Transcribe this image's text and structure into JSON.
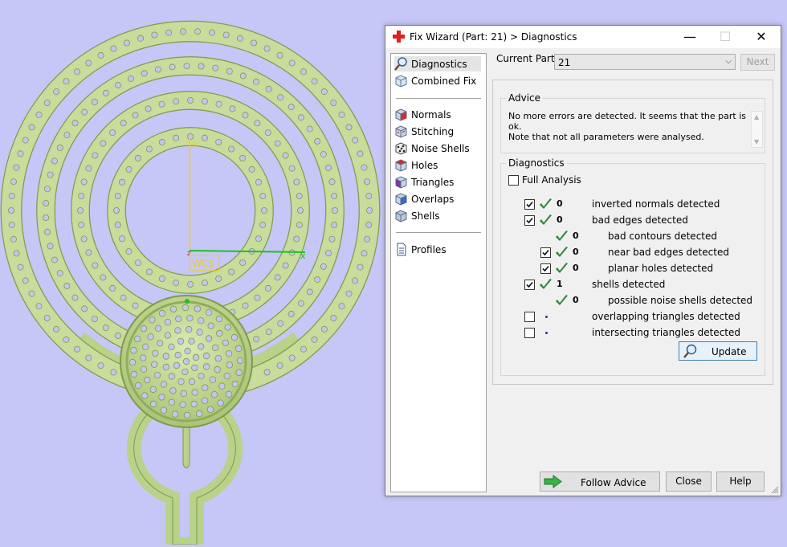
{
  "viewport": {
    "wcs_label": "WCS",
    "axis_x": "x",
    "axis_y": "y",
    "axis_z": "z",
    "colors": {
      "background": "#c6c6f7",
      "model": "#c8dc9c",
      "model_dark": "#7f9a4a",
      "holes": "#c4c4f2",
      "axis_y": "#f0d000",
      "axis_x": "#20c020",
      "axis_z": "#d02020"
    }
  },
  "dialog": {
    "title": "Fix Wizard (Part: 21) > Diagnostics",
    "window_buttons": {
      "minimize": "—",
      "maximize": "☐",
      "close": "✕"
    },
    "nav": {
      "group1": [
        {
          "label": "Diagnostics",
          "icon": "magnifier-icon",
          "selected": true
        },
        {
          "label": "Combined Fix",
          "icon": "cube-icon"
        }
      ],
      "group2": [
        {
          "label": "Normals",
          "icon": "normals-cube-icon"
        },
        {
          "label": "Stitching",
          "icon": "stitching-cube-icon"
        },
        {
          "label": "Noise Shells",
          "icon": "noise-shells-icon"
        },
        {
          "label": "Holes",
          "icon": "holes-cube-icon"
        },
        {
          "label": "Triangles",
          "icon": "triangles-cube-icon"
        },
        {
          "label": "Overlaps",
          "icon": "overlaps-cube-icon"
        },
        {
          "label": "Shells",
          "icon": "shells-cube-icon"
        }
      ],
      "group3": [
        {
          "label": "Profiles",
          "icon": "document-icon"
        }
      ]
    },
    "current_part": {
      "label": "Current Part:",
      "value": "21"
    },
    "next_label": "Next",
    "advice": {
      "title": "Advice",
      "line1": "No more errors are detected. It seems that the part is ok.",
      "line2": "Note that not all parameters were analysed."
    },
    "diagnostics": {
      "title": "Diagnostics",
      "full_analysis_label": "Full Analysis",
      "full_analysis_checked": false,
      "rows": [
        {
          "label": "inverted normals detected",
          "checkbox": true,
          "checked": true,
          "passed": true,
          "count": "0",
          "indent": 0
        },
        {
          "label": "bad edges detected",
          "checkbox": true,
          "checked": true,
          "passed": true,
          "count": "0",
          "indent": 0
        },
        {
          "label": "bad contours detected",
          "checkbox": false,
          "checked": false,
          "passed": true,
          "count": "0",
          "indent": 1
        },
        {
          "label": "near bad edges detected",
          "checkbox": true,
          "checked": true,
          "passed": true,
          "count": "0",
          "indent": 1
        },
        {
          "label": "planar holes detected",
          "checkbox": true,
          "checked": true,
          "passed": true,
          "count": "0",
          "indent": 1
        },
        {
          "label": "shells detected",
          "checkbox": true,
          "checked": true,
          "passed": true,
          "count": "1",
          "indent": 0
        },
        {
          "label": "possible noise shells detected",
          "checkbox": false,
          "checked": false,
          "passed": true,
          "count": "0",
          "indent": 1
        },
        {
          "label": "overlapping triangles detected",
          "checkbox": true,
          "checked": false,
          "passed": false,
          "count": "",
          "indent": 0
        },
        {
          "label": "intersecting triangles detected",
          "checkbox": true,
          "checked": false,
          "passed": false,
          "count": "",
          "indent": 0
        }
      ],
      "update_label": "Update"
    },
    "buttons": {
      "follow_advice": "Follow Advice",
      "close": "Close",
      "help": "Help"
    },
    "colors": {
      "check_green": "#2e8b3a",
      "arrow_green": "#37b34a",
      "selected_bg": "#e5e5e5"
    }
  }
}
